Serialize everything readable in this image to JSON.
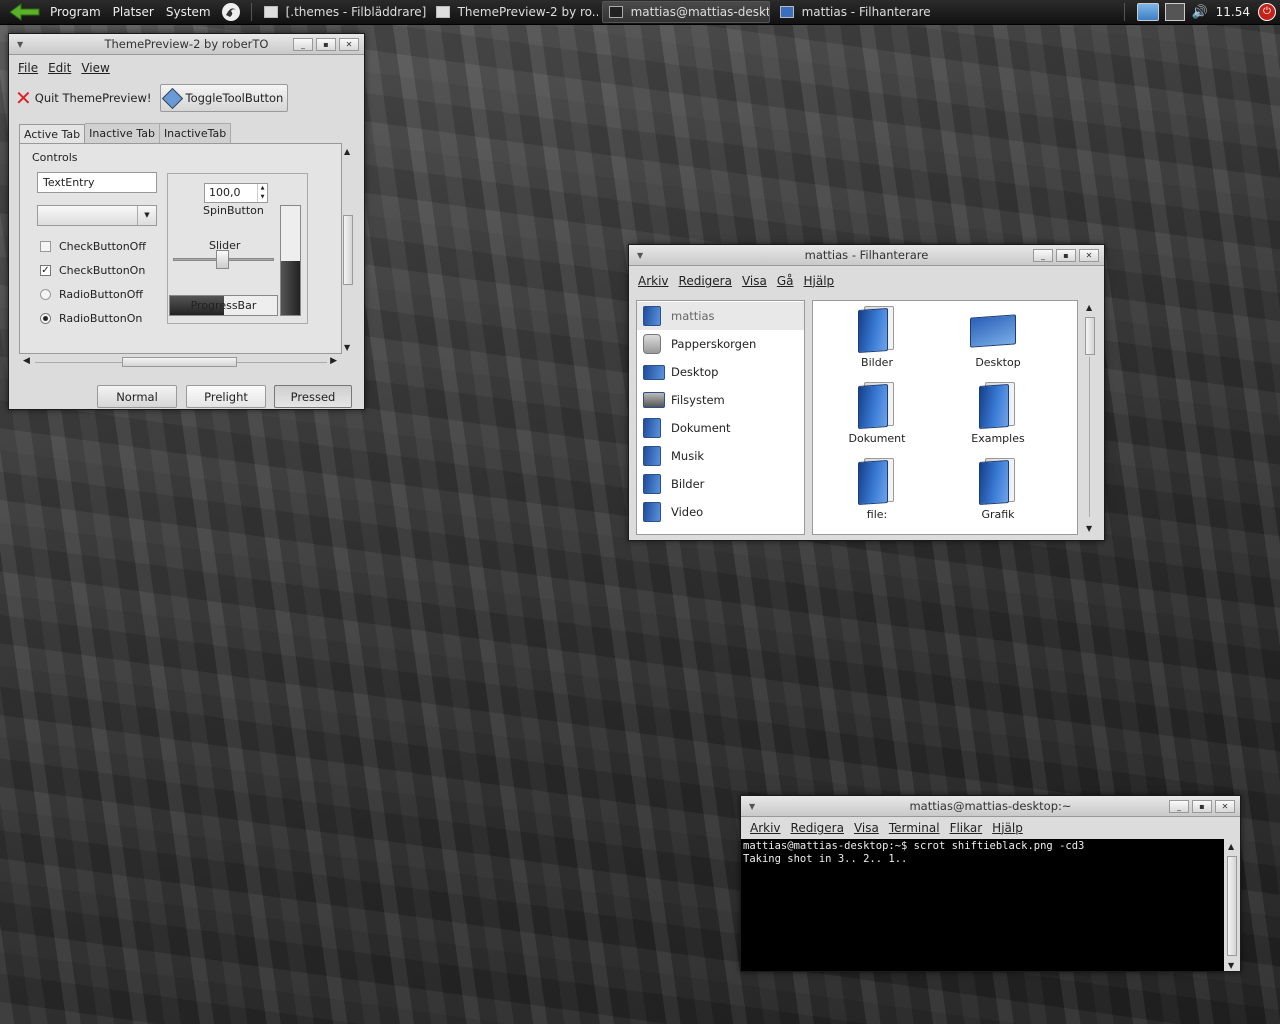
{
  "panel": {
    "menus": [
      "Program",
      "Platser",
      "System"
    ],
    "tasks": [
      {
        "label": "[.themes - Filbläddrare]",
        "icon": "file-browser-icon"
      },
      {
        "label": "ThemePreview-2 by ro...",
        "icon": "window-icon"
      },
      {
        "label": "mattias@mattias-deskt...",
        "icon": "terminal-icon"
      },
      {
        "label": "mattias - Filhanterare",
        "icon": "file-manager-icon"
      }
    ],
    "clock": "11.54"
  },
  "themepreview": {
    "title": "ThemePreview-2 by roberTO",
    "menu": [
      "File",
      "Edit",
      "View"
    ],
    "toolbar": {
      "quit": "Quit ThemePreview!",
      "toggle": "ToggleToolButton"
    },
    "tabs": [
      "Active Tab",
      "Inactive Tab",
      "InactiveTab"
    ],
    "controls_label": "Controls",
    "text_entry": "TextEntry",
    "checkbox_off": "CheckButtonOff",
    "checkbox_on": "CheckButtonOn",
    "radio_off": "RadioButtonOff",
    "radio_on": "RadioButtonOn",
    "spin_value": "100,0",
    "spin_label": "SpinButton",
    "slider_label": "Slider",
    "progress_label": "ProgressBar",
    "progress_value": 0.5,
    "vbar_fill": 0.5,
    "buttons": {
      "normal": "Normal",
      "prelight": "Prelight",
      "pressed": "Pressed"
    }
  },
  "filemanager": {
    "title": "mattias - Filhanterare",
    "menu": [
      "Arkiv",
      "Redigera",
      "Visa",
      "Gå",
      "Hjälp"
    ],
    "sidebar": [
      {
        "label": "mattias",
        "icon": "home-folder-icon"
      },
      {
        "label": "Papperskorgen",
        "icon": "trash-icon"
      },
      {
        "label": "Desktop",
        "icon": "desktop-icon"
      },
      {
        "label": "Filsystem",
        "icon": "harddisk-icon"
      },
      {
        "label": "Dokument",
        "icon": "folder-icon"
      },
      {
        "label": "Musik",
        "icon": "folder-icon"
      },
      {
        "label": "Bilder",
        "icon": "folder-icon"
      },
      {
        "label": "Video",
        "icon": "folder-icon"
      }
    ],
    "items": [
      "Bilder",
      "Desktop",
      "Dokument",
      "Examples",
      "file:",
      "Grafik"
    ]
  },
  "terminal": {
    "title": "mattias@mattias-desktop:~",
    "menu": [
      "Arkiv",
      "Redigera",
      "Visa",
      "Terminal",
      "Flikar",
      "Hjälp"
    ],
    "lines": [
      "mattias@mattias-desktop:~$ scrot shiftieblack.png -cd3",
      "Taking shot in 3.. 2.. 1.."
    ]
  }
}
